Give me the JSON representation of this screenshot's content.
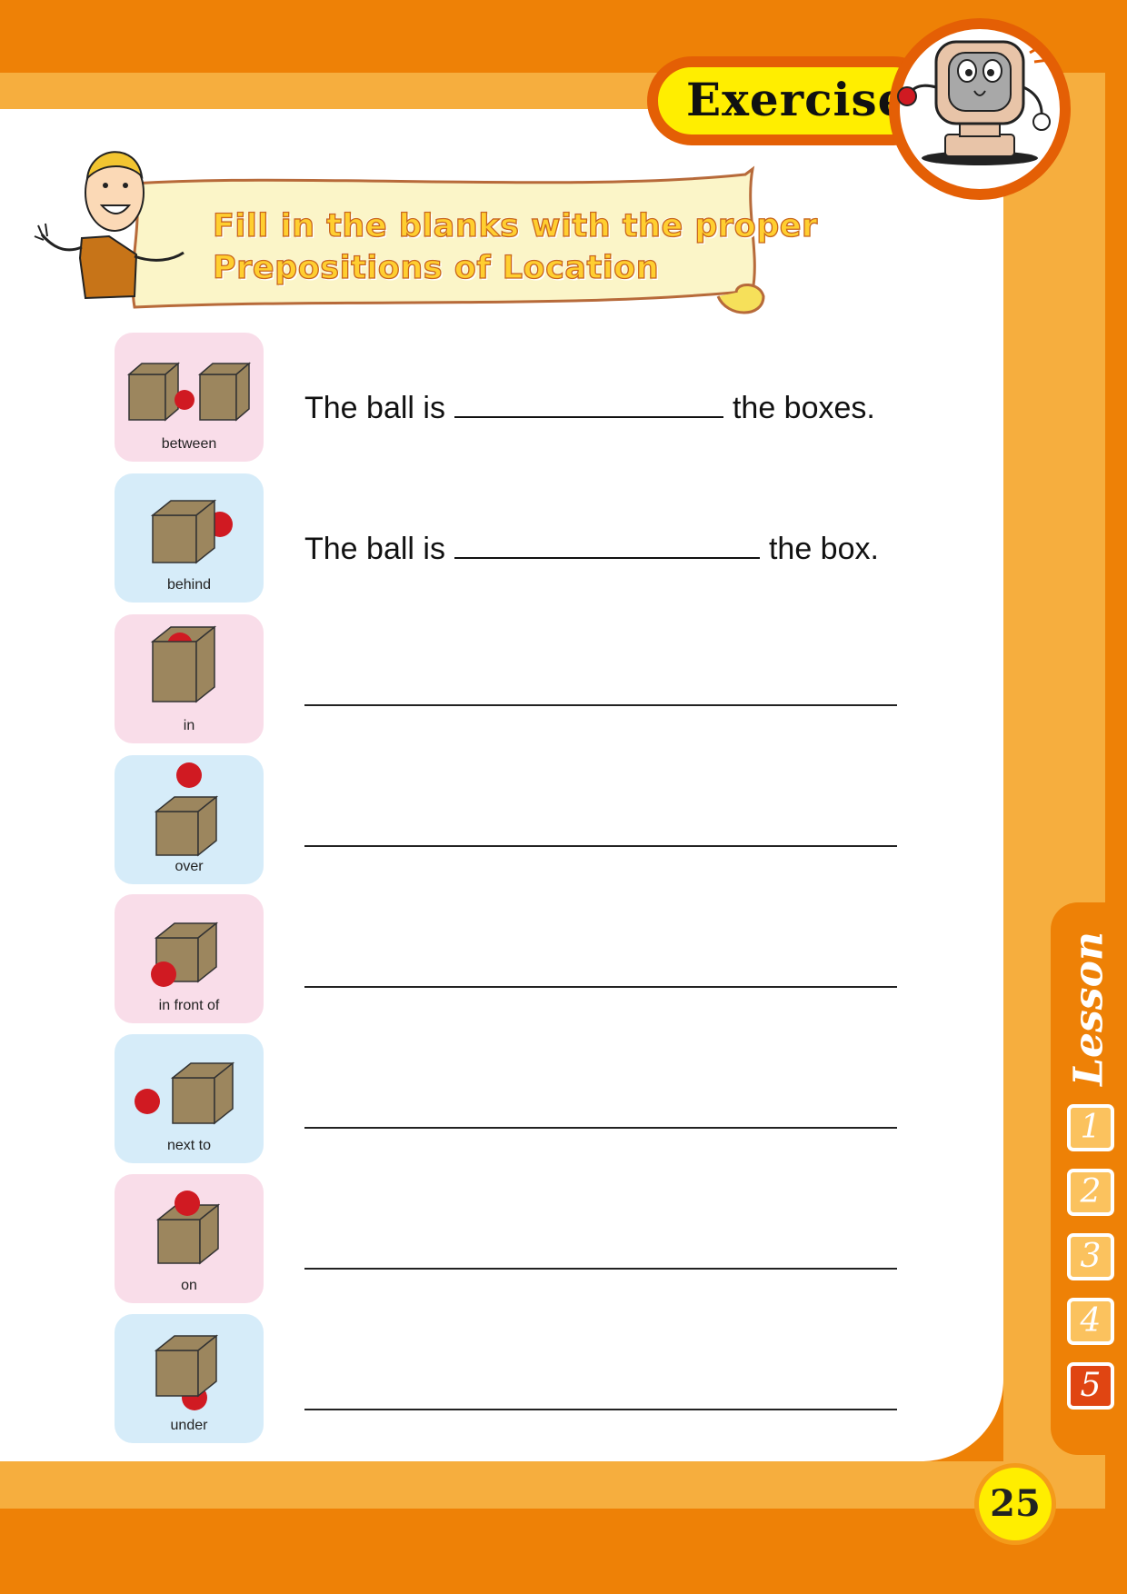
{
  "header": {
    "badge_label": "Exercise"
  },
  "banner": {
    "line1": "Fill in the blanks with the proper",
    "line2": "Prepositions of Location"
  },
  "cards": [
    {
      "label": "between",
      "color": "pink"
    },
    {
      "label": "behind",
      "color": "blue"
    },
    {
      "label": "in",
      "color": "pink"
    },
    {
      "label": "over",
      "color": "blue"
    },
    {
      "label": "in front of",
      "color": "pink"
    },
    {
      "label": "next to",
      "color": "blue"
    },
    {
      "label": "on",
      "color": "pink"
    },
    {
      "label": "under",
      "color": "blue"
    }
  ],
  "sentences": [
    {
      "start": "The ball is",
      "end": "the boxes."
    },
    {
      "start": "The ball is",
      "end": "the box."
    }
  ],
  "lesson_tab": {
    "word": "Lesson",
    "numbers": [
      "1",
      "2",
      "3",
      "4",
      "5"
    ],
    "current": "5"
  },
  "footer": {
    "page_number": "25"
  },
  "colors": {
    "frame_orange": "#ee8106",
    "frame_light": "#f6ae3e",
    "card_pink": "#f9dde9",
    "card_blue": "#d6ecf9",
    "box_brown": "#9c865e",
    "ball_red": "#d01a22",
    "badge_yellow": "#ffee00"
  }
}
